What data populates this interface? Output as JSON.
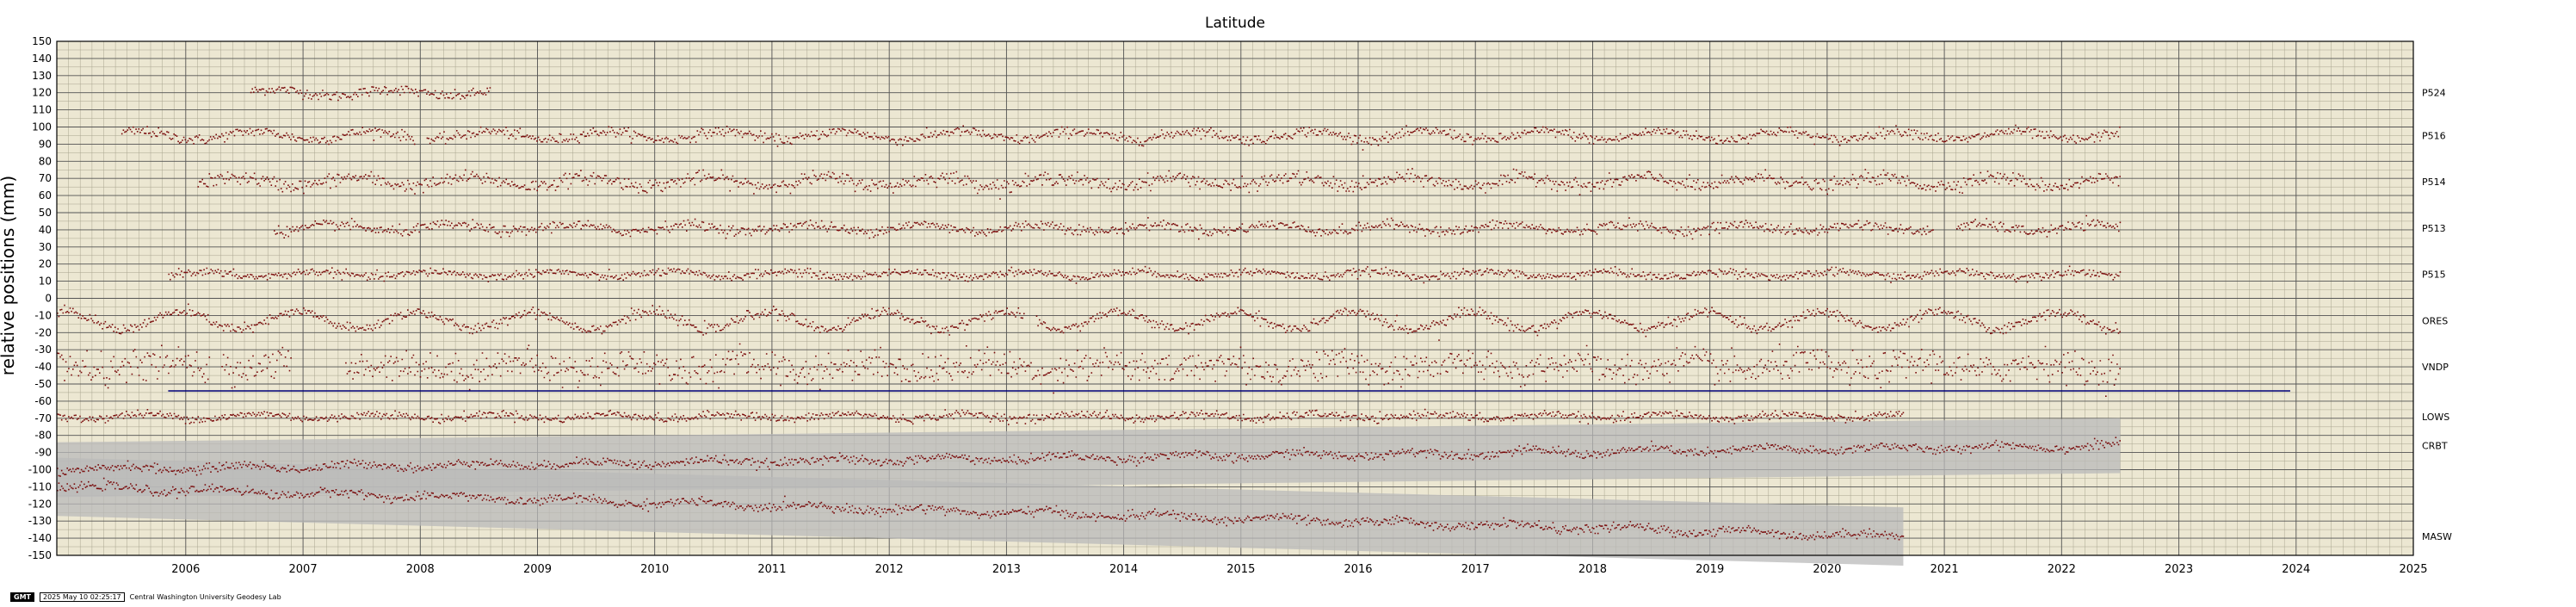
{
  "chart_data": {
    "type": "scatter",
    "title": "Latitude",
    "ylabel": "relative positions (mm)",
    "xlabel": "",
    "xlim": [
      2005.4,
      2025.5
    ],
    "ylim": [
      -150,
      150
    ],
    "y_ticks": [
      150,
      140,
      130,
      120,
      110,
      100,
      90,
      80,
      70,
      60,
      50,
      40,
      30,
      20,
      10,
      0,
      -10,
      -20,
      -30,
      -40,
      -50,
      -60,
      -70,
      -80,
      -90,
      -100,
      -110,
      -120,
      -130,
      -140,
      -150
    ],
    "x_ticks": [
      "2006",
      "2007",
      "2008",
      "2009",
      "2010",
      "2011",
      "2012",
      "2013",
      "2014",
      "2015",
      "2016",
      "2017",
      "2018",
      "2019",
      "2020",
      "2021",
      "2022",
      "2023",
      "2024",
      "2025"
    ],
    "grid": true,
    "background_color": "#ece7d2",
    "point_color": "#7a0c0c",
    "uncertainty_color": "#b9b9b9",
    "reference_line": {
      "y": -54,
      "x_range": [
        2006.35,
        2024.45
      ],
      "color": "#00007a"
    },
    "series": [
      {
        "name": "P524",
        "offset": 120,
        "start": 2007.05,
        "end": 2009.1,
        "amplitude": 2,
        "noise": 1.5,
        "gaps": []
      },
      {
        "name": "P516",
        "offset": 95,
        "start": 2005.95,
        "end": 2023.0,
        "amplitude": 2.5,
        "noise": 1.5,
        "gaps": [
          [
            2008.45,
            2008.55
          ]
        ]
      },
      {
        "name": "P514",
        "offset": 68,
        "start": 2006.6,
        "end": 2023.0,
        "amplitude": 2.5,
        "noise": 2.0,
        "gaps": []
      },
      {
        "name": "P513",
        "offset": 41,
        "start": 2007.25,
        "end": 2023.0,
        "amplitude": 2,
        "noise": 1.5,
        "gaps": [
          [
            2021.4,
            2021.6
          ]
        ]
      },
      {
        "name": "P515",
        "offset": 14,
        "start": 2006.35,
        "end": 2023.0,
        "amplitude": 1.5,
        "noise": 1.2,
        "gaps": []
      },
      {
        "name": "ORES",
        "offset": -13,
        "start": 2005.4,
        "end": 2023.0,
        "amplitude": 5,
        "noise": 1.5,
        "gaps": [
          [
            2013.65,
            2013.75
          ]
        ]
      },
      {
        "name": "VNDP",
        "offset": -40,
        "start": 2005.4,
        "end": 2023.0,
        "amplitude": 2.5,
        "noise": 4.5,
        "gaps": [
          [
            2006.7,
            2006.8
          ],
          [
            2007.4,
            2007.85
          ]
        ]
      },
      {
        "name": "LOWS",
        "offset": -69,
        "start": 2005.4,
        "end": 2021.15,
        "amplitude": 1.5,
        "noise": 1.2,
        "gaps": []
      },
      {
        "name": "CRBT",
        "offset": -100,
        "start": 2005.4,
        "end": 2023.0,
        "amplitude": 1.5,
        "noise": 1.3,
        "gaps": [],
        "trend_to": -86,
        "band": 16
      },
      {
        "name": "MASW",
        "offset": -110,
        "start": 2005.4,
        "end": 2021.15,
        "amplitude": 1.5,
        "noise": 1.3,
        "gaps": [],
        "trend_to": -139,
        "band": 17
      }
    ]
  },
  "footer": {
    "logo_text": "GMT",
    "timestamp": "2025 May 10 02:25:17",
    "lab": "Central Washington University Geodesy Lab"
  }
}
